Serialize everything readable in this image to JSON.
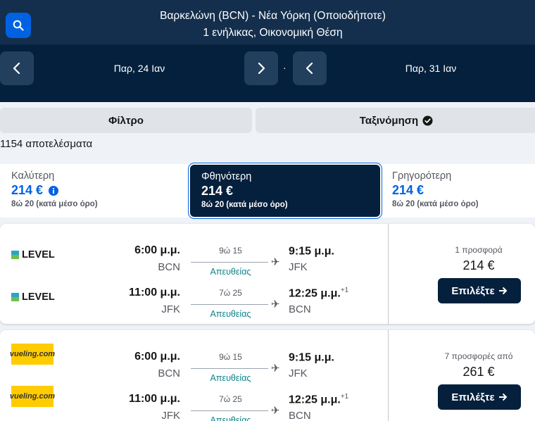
{
  "header": {
    "route": "Βαρκελώνη (BCN) - Νέα Υόρκη (Οποιοδήποτε)",
    "passengers": "1 ενήλικας, Οικονομική Θέση",
    "depart_date": "Παρ, 24 Ιαν",
    "return_date": "Παρ, 31 Ιαν",
    "separator": "·"
  },
  "filters": {
    "filter_label": "Φίλτρο",
    "sort_label": "Ταξινόμηση"
  },
  "results_count": "1154 αποτελέσματα",
  "sort_options": [
    {
      "title": "Καλύτερη",
      "price": "214 €",
      "duration": "8ώ 20 (κατά μέσο όρο)",
      "selected": false
    },
    {
      "title": "Φθηνότερη",
      "price": "214 €",
      "duration": "8ώ 20 (κατά μέσο όρο)",
      "selected": true
    },
    {
      "title": "Γρηγορότερη",
      "price": "214 €",
      "duration": "8ώ 20 (κατά μέσο όρο)",
      "selected": false
    }
  ],
  "results": [
    {
      "airline": "LEVEL",
      "logo_type": "level",
      "legs": [
        {
          "dep_time": "6:00 μ.μ.",
          "dep_airport": "BCN",
          "duration": "9ώ 15",
          "stops": "Απευθείας",
          "arr_time": "9:15 μ.μ.",
          "arr_offset": "",
          "arr_airport": "JFK"
        },
        {
          "dep_time": "11:00 μ.μ.",
          "dep_airport": "JFK",
          "duration": "7ώ 25",
          "stops": "Απευθείας",
          "arr_time": "12:25 μ.μ.",
          "arr_offset": "+1",
          "arr_airport": "BCN"
        }
      ],
      "offers": "1 προσφορά",
      "price": "214 €",
      "select_label": "Επιλέξτε"
    },
    {
      "airline": "vueling.com",
      "logo_type": "vueling",
      "legs": [
        {
          "dep_time": "6:00 μ.μ.",
          "dep_airport": "BCN",
          "duration": "9ώ 15",
          "stops": "Απευθείας",
          "arr_time": "9:15 μ.μ.",
          "arr_offset": "",
          "arr_airport": "JFK"
        },
        {
          "dep_time": "11:00 μ.μ.",
          "dep_airport": "JFK",
          "duration": "7ώ 25",
          "stops": "Απευθείας",
          "arr_time": "12:25 μ.μ.",
          "arr_offset": "+1",
          "arr_airport": "BCN"
        }
      ],
      "offers": "7 προσφορές από",
      "price": "261 €",
      "select_label": "Επιλέξτε"
    }
  ],
  "colors": {
    "header_bg": "#05203c",
    "accent": "#0062e3",
    "direct": "#0c838a"
  }
}
